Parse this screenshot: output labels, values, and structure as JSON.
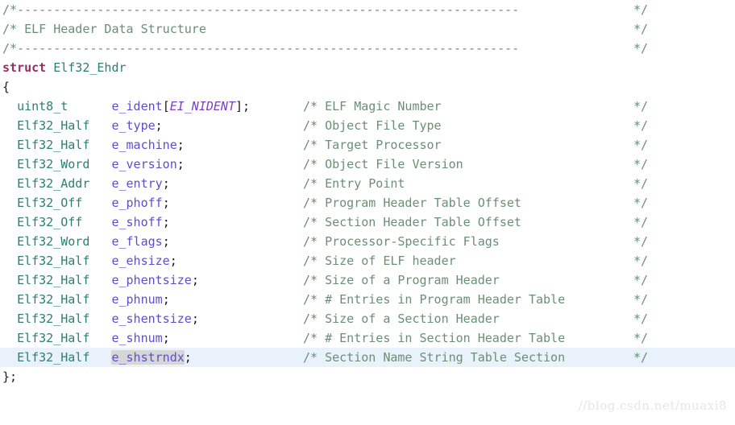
{
  "editor": {
    "language": "c",
    "background": "#ffffff",
    "highlight_row_color": "#e9f1fb",
    "occurrence_color": "#d6d6d6",
    "colors": {
      "keyword": "#9b2a66",
      "type": "#2d7f6f",
      "identifier": "#5a4fcf",
      "macro": "#7b3fc4",
      "comment": "#6a8f74",
      "punctuation": "#1a1a1a"
    }
  },
  "header": {
    "rule_open": "/*",
    "rule_dashes": "---------------------------------------------------------------------",
    "rule_close": "*/",
    "title_open": "/*",
    "title_text": " ELF Header Data Structure",
    "title_close": "*/"
  },
  "struct": {
    "keyword": "struct",
    "name": "Elf32_Ehdr",
    "open_brace": "{",
    "close_brace": "};"
  },
  "comment_open": "/*",
  "comment_close": "*/",
  "fields": [
    {
      "type": "uint8_t",
      "name": "e_ident",
      "array_open": "[",
      "array_size": "EI_NIDENT",
      "array_close": "]",
      "terminator": ";",
      "comment": " ELF Magic Number",
      "highlighted": false,
      "occurrence": false
    },
    {
      "type": "Elf32_Half",
      "name": "e_type",
      "array_open": "",
      "array_size": "",
      "array_close": "",
      "terminator": ";",
      "comment": " Object File Type",
      "highlighted": false,
      "occurrence": false
    },
    {
      "type": "Elf32_Half",
      "name": "e_machine",
      "array_open": "",
      "array_size": "",
      "array_close": "",
      "terminator": ";",
      "comment": " Target Processor",
      "highlighted": false,
      "occurrence": false
    },
    {
      "type": "Elf32_Word",
      "name": "e_version",
      "array_open": "",
      "array_size": "",
      "array_close": "",
      "terminator": ";",
      "comment": " Object File Version",
      "highlighted": false,
      "occurrence": false
    },
    {
      "type": "Elf32_Addr",
      "name": "e_entry",
      "array_open": "",
      "array_size": "",
      "array_close": "",
      "terminator": ";",
      "comment": " Entry Point",
      "highlighted": false,
      "occurrence": false
    },
    {
      "type": "Elf32_Off",
      "name": "e_phoff",
      "array_open": "",
      "array_size": "",
      "array_close": "",
      "terminator": ";",
      "comment": " Program Header Table Offset",
      "highlighted": false,
      "occurrence": false
    },
    {
      "type": "Elf32_Off",
      "name": "e_shoff",
      "array_open": "",
      "array_size": "",
      "array_close": "",
      "terminator": ";",
      "comment": " Section Header Table Offset",
      "highlighted": false,
      "occurrence": false
    },
    {
      "type": "Elf32_Word",
      "name": "e_flags",
      "array_open": "",
      "array_size": "",
      "array_close": "",
      "terminator": ";",
      "comment": " Processor-Specific Flags",
      "highlighted": false,
      "occurrence": false
    },
    {
      "type": "Elf32_Half",
      "name": "e_ehsize",
      "array_open": "",
      "array_size": "",
      "array_close": "",
      "terminator": ";",
      "comment": " Size of ELF header",
      "highlighted": false,
      "occurrence": false
    },
    {
      "type": "Elf32_Half",
      "name": "e_phentsize",
      "array_open": "",
      "array_size": "",
      "array_close": "",
      "terminator": ";",
      "comment": " Size of a Program Header",
      "highlighted": false,
      "occurrence": false
    },
    {
      "type": "Elf32_Half",
      "name": "e_phnum",
      "array_open": "",
      "array_size": "",
      "array_close": "",
      "terminator": ";",
      "comment": " # Entries in Program Header Table",
      "highlighted": false,
      "occurrence": false
    },
    {
      "type": "Elf32_Half",
      "name": "e_shentsize",
      "array_open": "",
      "array_size": "",
      "array_close": "",
      "terminator": ";",
      "comment": " Size of a Section Header",
      "highlighted": false,
      "occurrence": false
    },
    {
      "type": "Elf32_Half",
      "name": "e_shnum",
      "array_open": "",
      "array_size": "",
      "array_close": "",
      "terminator": ";",
      "comment": " # Entries in Section Header Table",
      "highlighted": false,
      "occurrence": false
    },
    {
      "type": "Elf32_Half",
      "name": "e_shstrndx",
      "array_open": "",
      "array_size": "",
      "array_close": "",
      "terminator": ";",
      "comment": " Section Name String Table Section",
      "highlighted": true,
      "occurrence": true
    }
  ],
  "watermark": "//blog.csdn.net/muaxi8"
}
